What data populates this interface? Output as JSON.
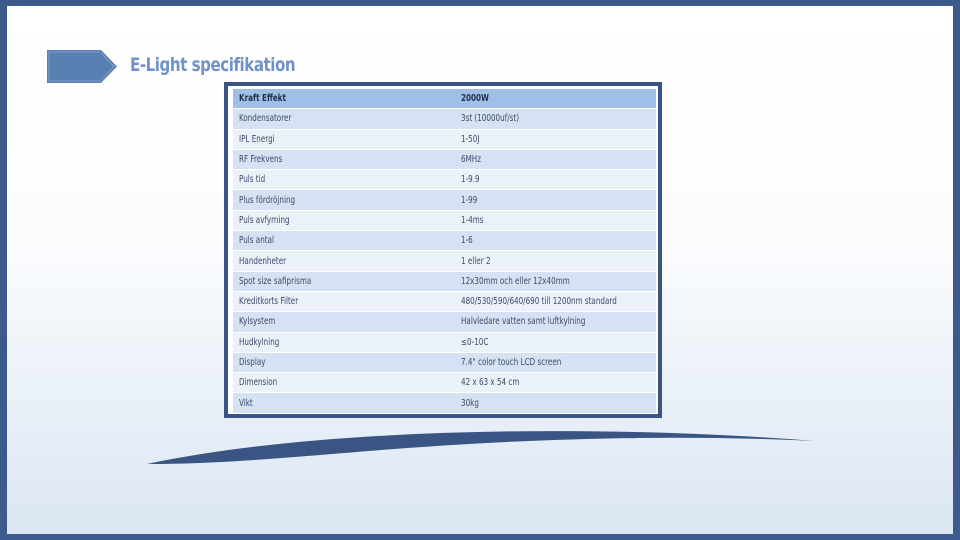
{
  "page": {
    "title": "E-Light specifikation"
  },
  "colors": {
    "outer_frame": "#3d5a8c",
    "title": "#6f93c6",
    "table_header": "#9fbfe6",
    "table_row_dark": "#d4e2f3",
    "table_row_light": "#eaf1f9",
    "table_border": "#3a5584"
  },
  "icons": {
    "title_marker": "arrow-right-icon"
  },
  "spec_table": {
    "rows": [
      {
        "label": "Kraft Effekt",
        "value": "2000W"
      },
      {
        "label": "Kondensatorer",
        "value": "3st (10000uf/st)"
      },
      {
        "label": "IPL Energi",
        "value": "1-50J"
      },
      {
        "label": "RF Frekvens",
        "value": "6MHz"
      },
      {
        "label": "Puls tid",
        "value": "1-9.9"
      },
      {
        "label": "Plus fördröjning",
        "value": "1-99"
      },
      {
        "label": "Puls avfyrning",
        "value": "1-4ms"
      },
      {
        "label": "Puls antal",
        "value": "1-6"
      },
      {
        "label": "Handenheter",
        "value": "1 eller 2"
      },
      {
        "label": "Spot size safiprisma",
        "value": "12x30mm och eller 12x40mm"
      },
      {
        "label": "Kreditkorts Filter",
        "value": "480/530/590/640/690 till 1200nm standard"
      },
      {
        "label": "Kylsystem",
        "value": "Halvledare vatten samt luftkylning"
      },
      {
        "label": "Hudkylning",
        "value": "≤0-10C"
      },
      {
        "label": "Display",
        "value": "7.4\" color touch LCD screen"
      },
      {
        "label": "Dimension",
        "value": "42 x 63 x 54 cm"
      },
      {
        "label": "Vikt",
        "value": "30kg"
      }
    ]
  }
}
